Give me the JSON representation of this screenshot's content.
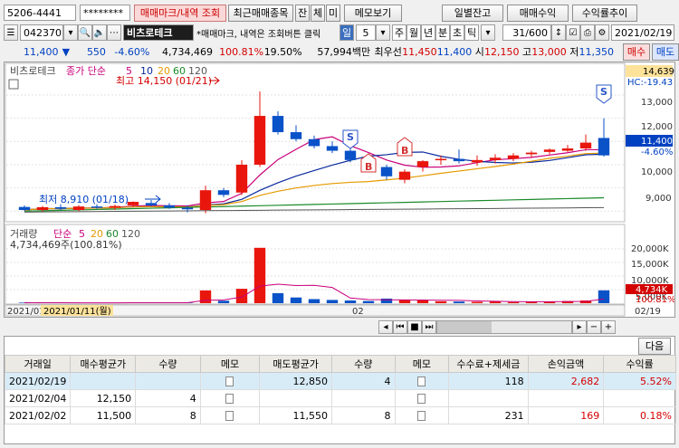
{
  "top": {
    "account": "5206-4441",
    "password": "********",
    "tabs": [
      "매매마크/내역 조회",
      "최근매매종목",
      "잔",
      "체",
      "미",
      "메모보기"
    ],
    "buttons": [
      "일별잔고",
      "매매수익",
      "수익률추이"
    ]
  },
  "toolbar": {
    "code": "042370",
    "name": "비츠로테크",
    "notice": "*매매마크, 내역은 조회버튼 클릭",
    "period_unit": "일",
    "period_value": "5",
    "period_tabs": [
      "주",
      "월",
      "년",
      "분",
      "초",
      "틱"
    ],
    "count": "31",
    "count_max": "/600",
    "date": "2021/02/19"
  },
  "quote": {
    "price": "11,400",
    "change": "550",
    "change_pct": "-4.60%",
    "volume": "4,734,469",
    "vol_ratio": "100.81%",
    "turnover": "19.50%",
    "amount": "57,994백만",
    "label_best": "최우선",
    "bid1": "11,450",
    "ask1": "11,400",
    "open_label": "시",
    "open": "12,150",
    "high_label": "고",
    "high": "13,000",
    "low_label": "저",
    "low": "11,350",
    "buy_btn": "매수",
    "sell_btn": "매도"
  },
  "chart": {
    "name": "비츠로테크",
    "ma_label": "종가 단순",
    "ma_periods": [
      "5",
      "10",
      "20",
      "60",
      "120"
    ],
    "ma_colors": [
      "#c8007a",
      "#0a2a9e",
      "#e69a00",
      "#1a8a2a",
      "#555555"
    ],
    "high_mark": "최고 14,150 (01/21)",
    "low_mark": "최저 8,910 (01/18)",
    "price_axis": [
      "14,639",
      "HC:-19.43",
      "13,000",
      "12,000",
      "11,400",
      "-4.60%",
      "10,000",
      "9,000"
    ],
    "vol_label": "거래량",
    "vol_ma_label": "단순",
    "vol_ma_periods": [
      "5",
      "20",
      "60",
      "120"
    ],
    "vol_text": "4,734,469주(100.81%)",
    "vol_axis": [
      "20,000K",
      "15,000K",
      "10,000K",
      "5,000K",
      "4,734K",
      "100.81%"
    ],
    "x_labels": [
      "2021/01",
      "2021/01/11(월)",
      "02",
      "02/19"
    ],
    "signals": [
      "S",
      "B",
      "B",
      "S"
    ]
  },
  "chart_data": {
    "type": "candlestick",
    "dates": [
      "01/04",
      "01/05",
      "01/06",
      "01/07",
      "01/08",
      "01/11",
      "01/12",
      "01/13",
      "01/14",
      "01/15",
      "01/18",
      "01/19",
      "01/20",
      "01/21",
      "01/22",
      "01/25",
      "01/26",
      "01/27",
      "01/28",
      "01/29",
      "02/01",
      "02/02",
      "02/03",
      "02/04",
      "02/05",
      "02/08",
      "02/09",
      "02/10",
      "02/15",
      "02/16",
      "02/17",
      "02/18",
      "02/19"
    ],
    "ohlc": [
      [
        9180,
        9250,
        9000,
        9050
      ],
      [
        9050,
        9220,
        8980,
        9170
      ],
      [
        9170,
        9300,
        9050,
        9100
      ],
      [
        9050,
        9260,
        9000,
        9200
      ],
      [
        9200,
        9300,
        9100,
        9150
      ],
      [
        9150,
        9280,
        9050,
        9220
      ],
      [
        9250,
        9420,
        9180,
        9400
      ],
      [
        9350,
        9480,
        9200,
        9250
      ],
      [
        9250,
        9350,
        9100,
        9150
      ],
      [
        9150,
        9250,
        8950,
        9080
      ],
      [
        9050,
        10100,
        8910,
        9900
      ],
      [
        9900,
        10000,
        9600,
        9700
      ],
      [
        9800,
        11200,
        9700,
        11000
      ],
      [
        11000,
        14150,
        10900,
        13100
      ],
      [
        13100,
        13300,
        12300,
        12400
      ],
      [
        12400,
        12700,
        12000,
        12100
      ],
      [
        12100,
        12250,
        11700,
        11800
      ],
      [
        11800,
        12000,
        11500,
        11600
      ],
      [
        11600,
        11700,
        11100,
        11200
      ],
      [
        11200,
        11300,
        10800,
        10900
      ],
      [
        10900,
        11000,
        10350,
        10500
      ],
      [
        10350,
        10800,
        10200,
        10700
      ],
      [
        10900,
        11200,
        10700,
        11150
      ],
      [
        11200,
        11400,
        11000,
        11250
      ],
      [
        11250,
        11650,
        11050,
        11150
      ],
      [
        11100,
        11400,
        10950,
        11200
      ],
      [
        11200,
        11450,
        11050,
        11300
      ],
      [
        11250,
        11500,
        11150,
        11400
      ],
      [
        11450,
        11600,
        11300,
        11520
      ],
      [
        11550,
        11700,
        11450,
        11650
      ],
      [
        11600,
        11850,
        11550,
        11700
      ],
      [
        11700,
        12300,
        11600,
        11950
      ],
      [
        12150,
        13000,
        11350,
        11400
      ]
    ],
    "volume_k": [
      200,
      150,
      100,
      120,
      90,
      150,
      300,
      180,
      120,
      140,
      4700,
      900,
      5300,
      20400,
      3700,
      2100,
      1500,
      1200,
      1000,
      800,
      1700,
      1300,
      1000,
      700,
      600,
      500,
      650,
      400,
      500,
      600,
      800,
      1000,
      4734
    ],
    "ylim": [
      8700,
      14700
    ],
    "vol_ylim": [
      0,
      22000
    ]
  },
  "grid": {
    "next_btn": "다음",
    "headers": [
      "거래일",
      "매수평균가",
      "수량",
      "메모",
      "매도평균가",
      "수량",
      "메모",
      "수수료+제세금",
      "손익금액",
      "수익률"
    ],
    "rows": [
      {
        "date": "2021/02/19",
        "buy_avg": "",
        "buy_qty": "",
        "sell_avg": "12,850",
        "sell_qty": "4",
        "fee": "118",
        "pnl": "2,682",
        "rate": "5.52%"
      },
      {
        "date": "2021/02/04",
        "buy_avg": "12,150",
        "buy_qty": "4",
        "sell_avg": "",
        "sell_qty": "",
        "fee": "",
        "pnl": "",
        "rate": ""
      },
      {
        "date": "2021/02/02",
        "buy_avg": "11,500",
        "buy_qty": "8",
        "sell_avg": "11,550",
        "sell_qty": "8",
        "fee": "231",
        "pnl": "169",
        "rate": "0.18%"
      }
    ]
  }
}
